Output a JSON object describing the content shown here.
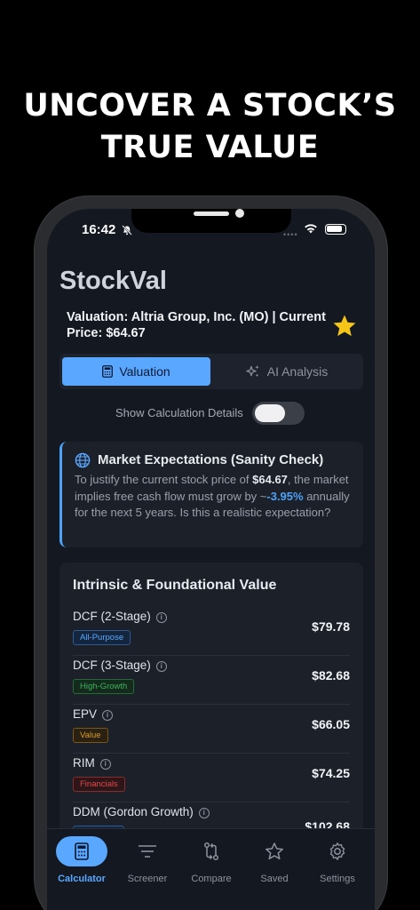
{
  "headline": {
    "line1": "UNCOVER A STOCK’S",
    "line2": "TRUE VALUE"
  },
  "status_bar": {
    "time": "16:42"
  },
  "app": {
    "title": "StockVal",
    "valuation_header": "Valuation: Altria Group, Inc. (MO) | Current Price: $64.67"
  },
  "segments": [
    {
      "label": "Valuation",
      "icon": "calculator-icon",
      "active": true
    },
    {
      "label": "AI Analysis",
      "icon": "sparkles-icon",
      "active": false
    }
  ],
  "toggle": {
    "label": "Show Calculation Details",
    "on": false
  },
  "market_expectations": {
    "title": "Market Expectations (Sanity Check)",
    "text_1": "To justify the current stock price of ",
    "price": "$64.67",
    "text_2": ", the market implies free cash flow must grow by ~",
    "growth": "-3.95%",
    "text_3": " annually for the next 5 years. Is this a realistic expectation?"
  },
  "intrinsic": {
    "title": "Intrinsic & Foundational Value",
    "rows": [
      {
        "name": "DCF (2-Stage)",
        "tag": "All-Purpose",
        "value": "$79.78"
      },
      {
        "name": "DCF (3-Stage)",
        "tag": "High-Growth",
        "value": "$82.68"
      },
      {
        "name": "EPV",
        "tag": "Value",
        "value": "$66.05"
      },
      {
        "name": "RIM",
        "tag": "Financials",
        "value": "$74.25"
      },
      {
        "name": "DDM (Gordon Growth)",
        "tag": "",
        "value": "$102.68"
      }
    ]
  },
  "colors": {
    "accent": "#5aa7ff",
    "tag_blue": "#4e8fd8",
    "tag_green": "#3bb35a",
    "tag_orange": "#d99a2b",
    "tag_red": "#e0484b",
    "star": "#f5c518"
  },
  "tabbar": [
    {
      "label": "Calculator",
      "icon": "calculator-icon",
      "active": true
    },
    {
      "label": "Screener",
      "icon": "filter-icon",
      "active": false
    },
    {
      "label": "Compare",
      "icon": "compare-icon",
      "active": false
    },
    {
      "label": "Saved",
      "icon": "star-outline-icon",
      "active": false
    },
    {
      "label": "Settings",
      "icon": "gear-icon",
      "active": false
    }
  ]
}
